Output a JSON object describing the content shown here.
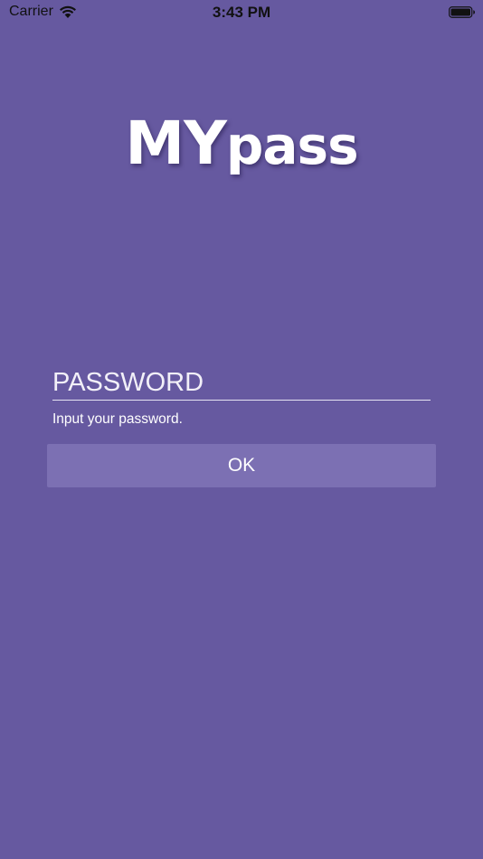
{
  "status_bar": {
    "carrier": "Carrier",
    "time": "3:43 PM",
    "wifi_icon": "wifi-icon",
    "battery_icon": "battery-icon"
  },
  "logo": {
    "text_my": "MY",
    "text_pass": "pass"
  },
  "login": {
    "password_placeholder": "PASSWORD",
    "password_value": "",
    "hint": "Input your password.",
    "ok_label": "OK"
  },
  "colors": {
    "background": "#6659a0",
    "button": "#7c70b3",
    "status_text": "#111111"
  }
}
